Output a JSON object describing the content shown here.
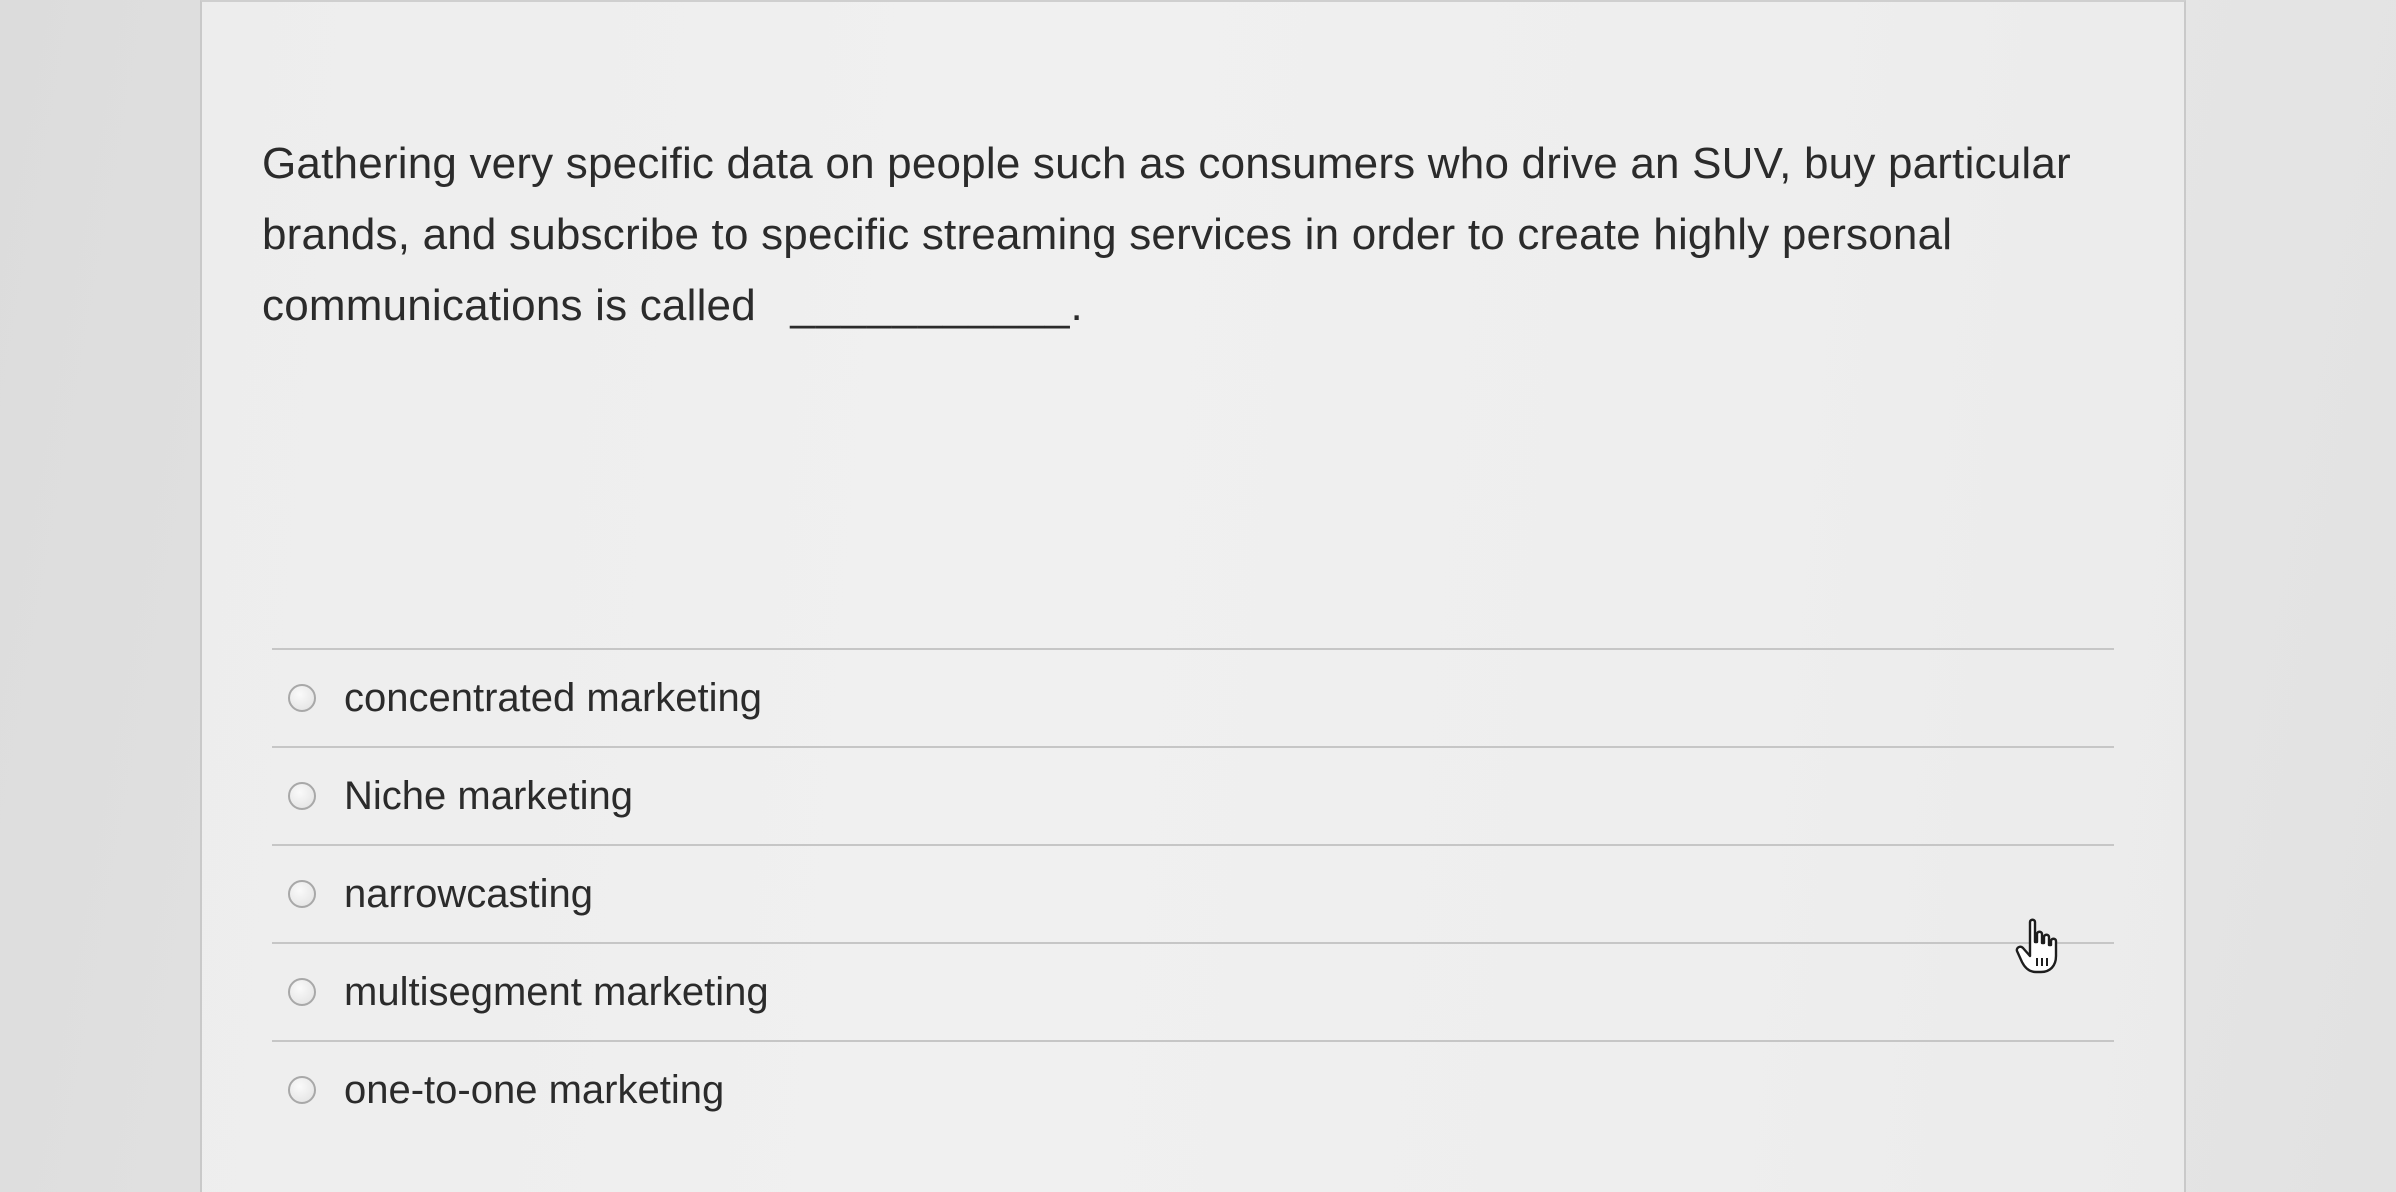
{
  "question": {
    "text": "Gathering very specific data on people such as consumers who drive an SUV, buy particular brands, and subscribe to specific streaming services in order to create highly personal communications is called",
    "blank": "___________."
  },
  "options": [
    {
      "label": "concentrated marketing"
    },
    {
      "label": "Niche marketing"
    },
    {
      "label": "narrowcasting"
    },
    {
      "label": "multisegment marketing"
    },
    {
      "label": "one-to-one marketing"
    }
  ],
  "icons": {
    "cursor": "hand-pointer-icon",
    "radio": "radio-button-icon"
  },
  "colors": {
    "text": "#2b2b2b",
    "divider": "#c6c6c6",
    "card_bg": "#efefef"
  }
}
